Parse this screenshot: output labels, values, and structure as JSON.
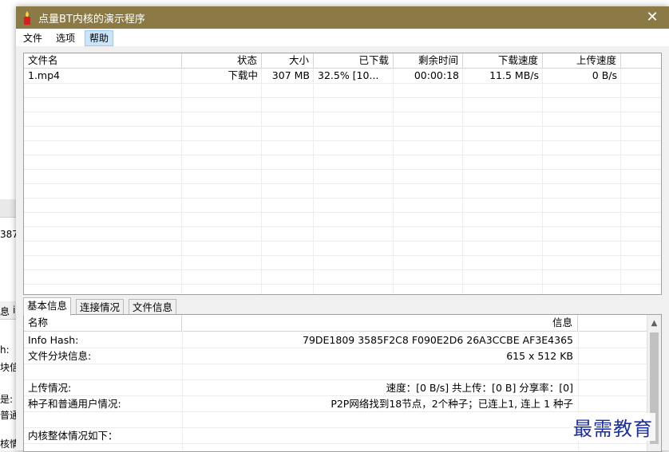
{
  "window": {
    "title": "点量BT内核的演示程序",
    "close_glyph": "✕"
  },
  "menu": [
    "文件",
    "选项",
    "帮助"
  ],
  "download_list": {
    "columns": [
      "文件名",
      "状态",
      "大小",
      "已下载",
      "剩余时间",
      "下载速度",
      "上传速度"
    ],
    "rows": [
      {
        "name": "1.mp4",
        "status": "下载中",
        "size": "307 MB",
        "downloaded": "32.5% [10...",
        "remaining": "00:00:18",
        "down_speed": "11.5 MB/s",
        "up_speed": "0 B/s"
      }
    ]
  },
  "tabs": [
    "基本信息",
    "连接情况",
    "文件信息"
  ],
  "info_table": {
    "columns": [
      "名称",
      "信息"
    ],
    "rows": [
      {
        "name": "Info Hash:",
        "value": "79DE1809 3585F2C8 F090E2D6 26A3CCBE AF3E4365"
      },
      {
        "name": "文件分块信息:",
        "value": "615 x 512 KB"
      },
      {
        "name": "",
        "value": ""
      },
      {
        "name": "上传情况:",
        "value": "速度：[0 B/s]  共上传：[0 B]  分享率：[0]"
      },
      {
        "name": "种子和普通用户情况:",
        "value": "P2P网络找到18节点，2个种子；已连上1, 连上 1 种子"
      },
      {
        "name": "",
        "value": ""
      },
      {
        "name": "内核整体情况如下：",
        "value": ""
      }
    ]
  },
  "background_window": {
    "fragments": [
      "387",
      "息",
      "i",
      "h:",
      "块信息",
      "是:",
      "普通用",
      "核情况"
    ]
  },
  "watermark": "最需教育",
  "colors": {
    "titlebar": "#8b7a45",
    "menu_active": "#cce4f7",
    "watermark": "#1a2ea8"
  }
}
